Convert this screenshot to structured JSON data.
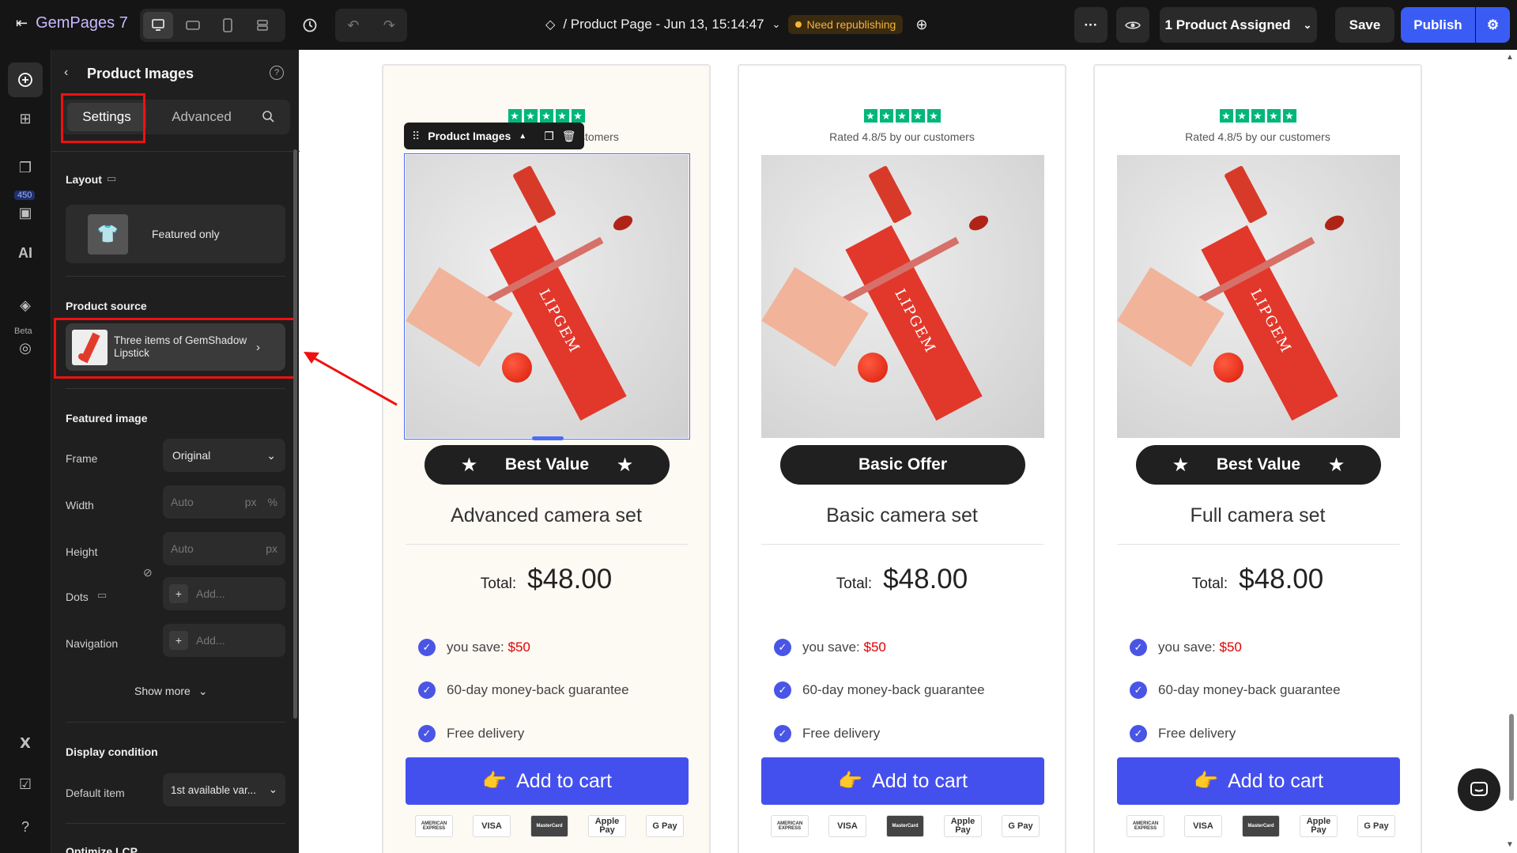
{
  "topbar": {
    "app_name": "GemPages 7",
    "page_title": "/ Product Page - Jun 13, 15:14:47",
    "status_badge": "Need republishing",
    "assign_label": "1 Product Assigned",
    "save_label": "Save",
    "publish_label": "Publish"
  },
  "rail": {
    "count_badge": "450",
    "beta_label": "Beta"
  },
  "panel": {
    "title": "Product Images",
    "tabs": [
      "Settings",
      "Advanced"
    ],
    "layout_label": "Layout",
    "layout_value": "Featured only",
    "source_label": "Product source",
    "source_value": "Three items of GemShadow Lipstick",
    "featured_label": "Featured image",
    "frame_label": "Frame",
    "frame_value": "Original",
    "width_label": "Width",
    "width_placeholder": "Auto",
    "width_units": [
      "px",
      "%"
    ],
    "height_label": "Height",
    "height_placeholder": "Auto",
    "height_unit": "px",
    "dots_label": "Dots",
    "dots_add": "Add...",
    "nav_label": "Navigation",
    "nav_add": "Add...",
    "show_more": "Show more",
    "display_condition": "Display condition",
    "default_item_label": "Default item",
    "default_item_value": "1st available var...",
    "optimize_label": "Optimize LCP"
  },
  "toolbar_chip": {
    "label": "Product Images"
  },
  "cards": [
    {
      "rating": "Rated 4.8/5 by our customers",
      "badge": "Best Value",
      "badge_stars": true,
      "name": "Advanced camera set",
      "total_label": "Total:",
      "price": "$48.00",
      "save_label": "you save:",
      "save_value": "$50",
      "features": [
        "60-day money-back guarantee",
        "Free delivery"
      ],
      "cart": "Add to cart"
    },
    {
      "rating": "Rated 4.8/5 by our customers",
      "badge": "Basic Offer",
      "badge_stars": false,
      "name": "Basic camera set",
      "total_label": "Total:",
      "price": "$48.00",
      "save_label": "you save:",
      "save_value": "$50",
      "features": [
        "60-day money-back guarantee",
        "Free delivery"
      ],
      "cart": "Add to cart"
    },
    {
      "rating": "Rated 4.8/5 by our customers",
      "badge": "Best Value",
      "badge_stars": true,
      "name": "Full camera set",
      "total_label": "Total:",
      "price": "$48.00",
      "save_label": "you save:",
      "save_value": "$50",
      "features": [
        "60-day money-back guarantee",
        "Free delivery"
      ],
      "cart": "Add to cart"
    }
  ],
  "payments": [
    "AMERICAN EXPRESS",
    "VISA",
    "MasterCard",
    "Apple Pay",
    "G Pay"
  ],
  "product_text": "LIPGEM",
  "colors": {
    "accent": "#4450ee",
    "highlight": "#e00000",
    "trustpilot": "#00b67a"
  }
}
